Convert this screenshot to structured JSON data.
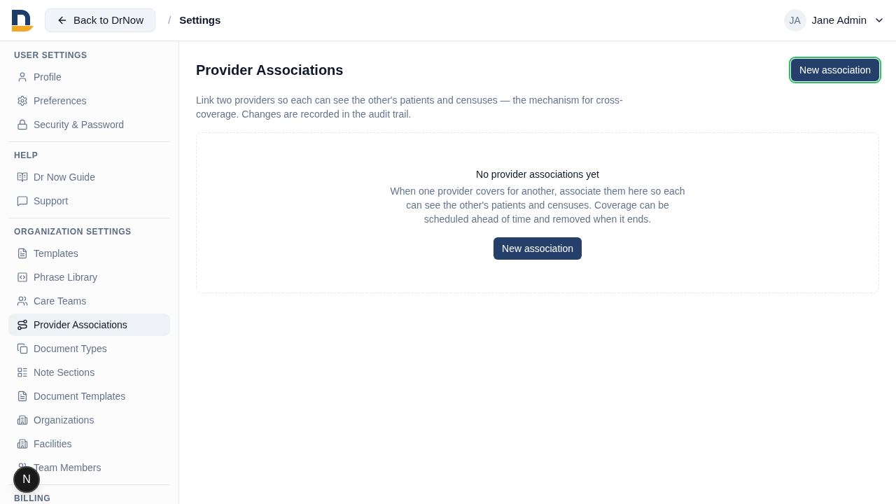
{
  "header": {
    "back_button": {
      "label": "Back to DrNow"
    },
    "breadcrumb_separator": "/",
    "breadcrumb": "Settings",
    "user": {
      "initials": "JA",
      "name": "Jane Admin"
    }
  },
  "sidebar": {
    "sections": [
      {
        "title": "USER SETTINGS",
        "items": [
          {
            "label": "Profile",
            "selected": false
          },
          {
            "label": "Preferences",
            "selected": false
          },
          {
            "label": "Security & Password",
            "selected": false
          }
        ]
      },
      {
        "title": "HELP",
        "items": [
          {
            "label": "Dr Now Guide",
            "selected": false
          },
          {
            "label": "Support",
            "selected": false
          }
        ]
      },
      {
        "title": "ORGANIZATION SETTINGS",
        "items": [
          {
            "label": "Templates",
            "selected": false
          },
          {
            "label": "Phrase Library",
            "selected": false
          },
          {
            "label": "Care Teams",
            "selected": false
          },
          {
            "label": "Provider Associations",
            "selected": true
          },
          {
            "label": "Document Types",
            "selected": false
          },
          {
            "label": "Note Sections",
            "selected": false
          },
          {
            "label": "Document Templates",
            "selected": false
          },
          {
            "label": "Organizations",
            "selected": false
          },
          {
            "label": "Facilities",
            "selected": false
          },
          {
            "label": "Team Members",
            "selected": false
          }
        ]
      },
      {
        "title": "BILLING"
      }
    ]
  },
  "main": {
    "title": "Provider Associations",
    "new_button": {
      "label": "New association",
      "focused": true
    },
    "description": "Link two providers so each can see the other's patients and censuses — the mechanism for cross-coverage. Changes are recorded in the audit trail.",
    "empty_state": {
      "title": "No provider associations yet",
      "text": "When one provider covers for another, associate them here so each can see the other's patients and censuses. Coverage can be scheduled ahead of time and removed when it ends.",
      "button": {
        "label": "New association"
      }
    }
  },
  "dev_badge": {
    "label": "N"
  }
}
